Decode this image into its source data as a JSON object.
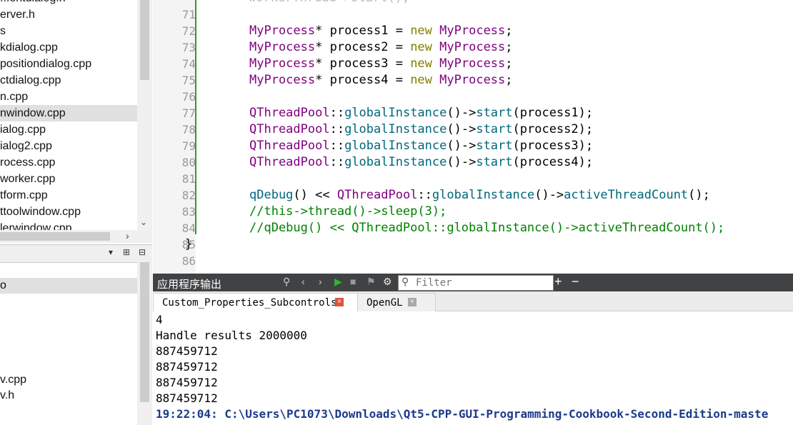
{
  "left_pane": {
    "files_top": [
      {
        "label": "...entdialog.h",
        "selected": false
      },
      {
        "label": "erver.h",
        "selected": false
      },
      {
        "label": "s",
        "selected": false
      },
      {
        "label": "kdialog.cpp",
        "selected": false
      },
      {
        "label": "positiondialog.cpp",
        "selected": false
      },
      {
        "label": "ctdialog.cpp",
        "selected": false
      },
      {
        "label": "n.cpp",
        "selected": false
      },
      {
        "label": "nwindow.cpp",
        "selected": true
      },
      {
        "label": "ialog.cpp",
        "selected": false
      },
      {
        "label": "ialog2.cpp",
        "selected": false
      },
      {
        "label": "rocess.cpp",
        "selected": false
      },
      {
        "label": "worker.cpp",
        "selected": false
      },
      {
        "label": "tform.cpp",
        "selected": false
      },
      {
        "label": "ttoolwindow.cpp",
        "selected": false
      },
      {
        "label": "lerwindow.cpp",
        "selected": false
      }
    ],
    "files_bottom": [
      {
        "label": "",
        "selected": false
      },
      {
        "label": "o",
        "selected": true
      },
      {
        "label": "",
        "selected": false
      },
      {
        "label": "",
        "selected": false
      },
      {
        "label": "",
        "selected": false
      },
      {
        "label": "",
        "selected": false
      },
      {
        "label": "",
        "selected": false
      },
      {
        "label": "v.cpp",
        "selected": false
      },
      {
        "label": "v.h",
        "selected": false
      }
    ],
    "toolbar": {
      "dropdown": "▾",
      "split": "⊞",
      "close": "⊟"
    }
  },
  "editor": {
    "lines": [
      {
        "n": "71",
        "tokens": [
          {
            "c": "op",
            "t": ""
          }
        ]
      },
      {
        "n": "72",
        "tokens": [
          {
            "c": "ty",
            "t": "MyProcess"
          },
          {
            "c": "op",
            "t": "* process1 = "
          },
          {
            "c": "kw",
            "t": "new"
          },
          {
            "c": "op",
            "t": " "
          },
          {
            "c": "ty",
            "t": "MyProcess"
          },
          {
            "c": "op",
            "t": ";"
          }
        ]
      },
      {
        "n": "73",
        "tokens": [
          {
            "c": "ty",
            "t": "MyProcess"
          },
          {
            "c": "op",
            "t": "* process2 = "
          },
          {
            "c": "kw",
            "t": "new"
          },
          {
            "c": "op",
            "t": " "
          },
          {
            "c": "ty",
            "t": "MyProcess"
          },
          {
            "c": "op",
            "t": ";"
          }
        ]
      },
      {
        "n": "74",
        "tokens": [
          {
            "c": "ty",
            "t": "MyProcess"
          },
          {
            "c": "op",
            "t": "* process3 = "
          },
          {
            "c": "kw",
            "t": "new"
          },
          {
            "c": "op",
            "t": " "
          },
          {
            "c": "ty",
            "t": "MyProcess"
          },
          {
            "c": "op",
            "t": ";"
          }
        ]
      },
      {
        "n": "75",
        "tokens": [
          {
            "c": "ty",
            "t": "MyProcess"
          },
          {
            "c": "op",
            "t": "* process4 = "
          },
          {
            "c": "kw",
            "t": "new"
          },
          {
            "c": "op",
            "t": " "
          },
          {
            "c": "ty",
            "t": "MyProcess"
          },
          {
            "c": "op",
            "t": ";"
          }
        ]
      },
      {
        "n": "76",
        "tokens": [
          {
            "c": "op",
            "t": ""
          }
        ]
      },
      {
        "n": "77",
        "tokens": [
          {
            "c": "ty",
            "t": "QThreadPool"
          },
          {
            "c": "op",
            "t": "::"
          },
          {
            "c": "fn",
            "t": "globalInstance"
          },
          {
            "c": "op",
            "t": "()->"
          },
          {
            "c": "fn",
            "t": "start"
          },
          {
            "c": "op",
            "t": "(process1);"
          }
        ]
      },
      {
        "n": "78",
        "tokens": [
          {
            "c": "ty",
            "t": "QThreadPool"
          },
          {
            "c": "op",
            "t": "::"
          },
          {
            "c": "fn",
            "t": "globalInstance"
          },
          {
            "c": "op",
            "t": "()->"
          },
          {
            "c": "fn",
            "t": "start"
          },
          {
            "c": "op",
            "t": "(process2);"
          }
        ]
      },
      {
        "n": "79",
        "tokens": [
          {
            "c": "ty",
            "t": "QThreadPool"
          },
          {
            "c": "op",
            "t": "::"
          },
          {
            "c": "fn",
            "t": "globalInstance"
          },
          {
            "c": "op",
            "t": "()->"
          },
          {
            "c": "fn",
            "t": "start"
          },
          {
            "c": "op",
            "t": "(process3);"
          }
        ]
      },
      {
        "n": "80",
        "tokens": [
          {
            "c": "ty",
            "t": "QThreadPool"
          },
          {
            "c": "op",
            "t": "::"
          },
          {
            "c": "fn",
            "t": "globalInstance"
          },
          {
            "c": "op",
            "t": "()->"
          },
          {
            "c": "fn",
            "t": "start"
          },
          {
            "c": "op",
            "t": "(process4);"
          }
        ]
      },
      {
        "n": "81",
        "tokens": [
          {
            "c": "op",
            "t": ""
          }
        ]
      },
      {
        "n": "82",
        "tokens": [
          {
            "c": "fn",
            "t": "qDebug"
          },
          {
            "c": "op",
            "t": "() << "
          },
          {
            "c": "ty",
            "t": "QThreadPool"
          },
          {
            "c": "op",
            "t": "::"
          },
          {
            "c": "fn",
            "t": "globalInstance"
          },
          {
            "c": "op",
            "t": "()->"
          },
          {
            "c": "fn",
            "t": "activeThreadCount"
          },
          {
            "c": "op",
            "t": "();"
          }
        ]
      },
      {
        "n": "83",
        "tokens": [
          {
            "c": "cm",
            "t": "//this->thread()->sleep(3);"
          }
        ]
      },
      {
        "n": "84",
        "tokens": [
          {
            "c": "cm",
            "t": "//qDebug() << QThreadPool::globalInstance()->activeThreadCount();"
          }
        ]
      },
      {
        "n": "85",
        "tokens": [
          {
            "c": "op",
            "t": "}"
          }
        ],
        "outdent": true
      },
      {
        "n": "86",
        "tokens": [
          {
            "c": "op",
            "t": ""
          }
        ]
      }
    ]
  },
  "output_pane": {
    "title": "应用程序输出",
    "filter_placeholder": "Filter",
    "tabs": [
      {
        "label": "Custom_Properties_Subcontrols",
        "active": true
      },
      {
        "label": "OpenGL",
        "active": false
      }
    ],
    "lines": [
      "4",
      "Handle results 2000000",
      "887459712",
      "887459712",
      "887459712",
      "887459712"
    ],
    "status_line": "19:22:04: C:\\Users\\PC1073\\Downloads\\Qt5-CPP-GUI-Programming-Cookbook-Second-Edition-maste"
  },
  "colors": {
    "type": "#800080",
    "keyword": "#808000",
    "function": "#00677c",
    "comment": "#008000",
    "modified_bar": "#2e9b2e",
    "output_toolbar": "#404244",
    "status_text": "#1b3a8c",
    "run_green": "#2fb52f",
    "tab_close_red": "#e0533c"
  }
}
